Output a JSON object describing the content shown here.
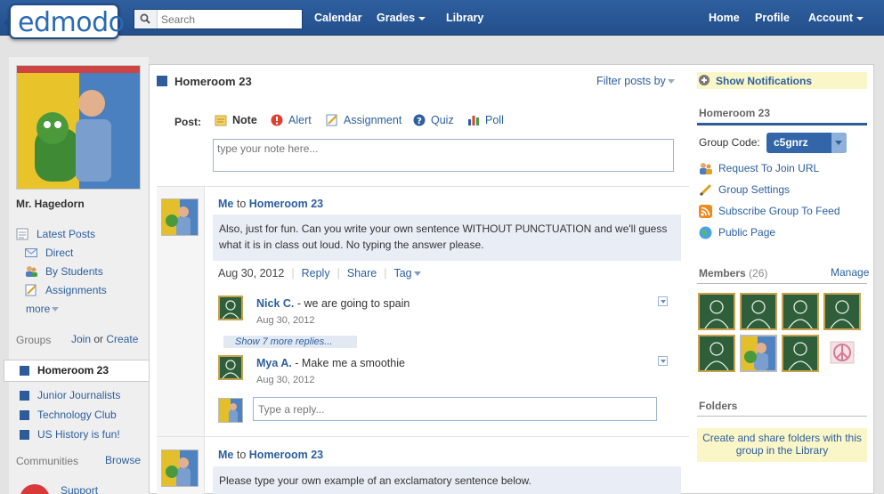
{
  "brand": {
    "logo_text": "edmodo"
  },
  "search": {
    "placeholder": "Search"
  },
  "topnav": {
    "calendar": "Calendar",
    "grades": "Grades",
    "library": "Library",
    "home": "Home",
    "profile": "Profile",
    "account": "Account"
  },
  "sidebar": {
    "username": "Mr. Hagedorn",
    "latest_posts": "Latest Posts",
    "direct": "Direct",
    "by_students": "By Students",
    "assignments": "Assignments",
    "more": "more",
    "groups_label": "Groups",
    "join": "Join",
    "or": "or",
    "create": "Create",
    "groups": [
      "Homeroom 23",
      "Junior Journalists",
      "Technology Club",
      "US History is fun!"
    ],
    "communities_label": "Communities",
    "browse": "Browse",
    "support": "Support"
  },
  "feed": {
    "title": "Homeroom 23",
    "filter": "Filter posts by",
    "post_label": "Post:",
    "post_types": [
      "Note",
      "Alert",
      "Assignment",
      "Quiz",
      "Poll"
    ],
    "note_placeholder": "type your note here...",
    "posts": [
      {
        "author": "Me",
        "to_word": "to",
        "target": "Homeroom 23",
        "body": "Also, just for fun. Can you write your own sentence WITHOUT PUNCTUATION and we'll guess what it is in class out loud. No typing the answer please.",
        "date": "Aug 30, 2012",
        "reply": "Reply",
        "share": "Share",
        "tag": "Tag",
        "replies": [
          {
            "name": "Nick C.",
            "text": " - we are going to spain",
            "date": "Aug 30, 2012"
          },
          {
            "name": "Mya A.",
            "text": " - Make me a smoothie",
            "date": "Aug 30, 2012"
          }
        ],
        "more_replies": "Show 7 more replies...",
        "reply_placeholder": "Type a reply..."
      },
      {
        "author": "Me",
        "to_word": "to",
        "target": "Homeroom 23",
        "body": "Please type your own example of an exclamatory sentence below."
      }
    ]
  },
  "right": {
    "notifications": "Show Notifications",
    "group_title": "Homeroom 23",
    "group_code_label": "Group Code:",
    "group_code": "c5gnrz",
    "links": [
      "Request To Join URL",
      "Group Settings",
      "Subscribe Group To Feed",
      "Public Page"
    ],
    "members_label": "Members",
    "members_count": "(26)",
    "manage": "Manage",
    "folders_label": "Folders",
    "folders_text": "Create and share folders with this group in the Library"
  },
  "colors": {
    "nav_blue": "#2f5f9e",
    "link_blue": "#2b5f9e",
    "highlight_yellow": "#fbf6c8",
    "post_bg": "#e9eef6"
  }
}
